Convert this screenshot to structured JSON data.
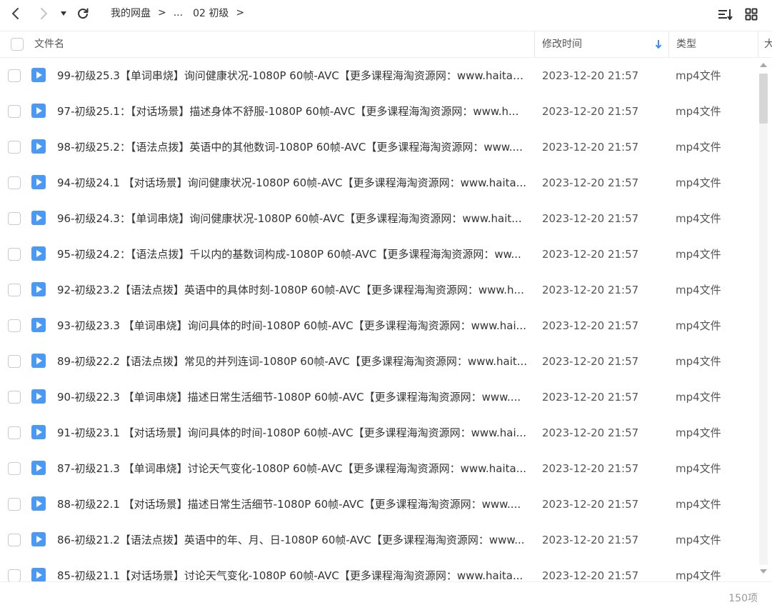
{
  "nav": {
    "back_icon": "chevron-left-icon",
    "forward_icon": "chevron-right-icon",
    "history_icon": "caret-down-icon",
    "refresh_icon": "refresh-icon"
  },
  "breadcrumb": {
    "root": "我的网盘",
    "ellipsis": "...",
    "current": "02 初级",
    "separator": ">"
  },
  "view": {
    "sort_icon": "sort-icon",
    "grid_icon": "grid-view-icon"
  },
  "columns": {
    "name": "文件名",
    "modified": "修改时间",
    "type": "类型",
    "size": "大"
  },
  "colors": {
    "accent": "#3b8ff0",
    "icon_blue": "#4a9af5"
  },
  "files": [
    {
      "name": "99-初级25.3【单词串烧】询问健康状况-1080P 60帧-AVC【更多课程海淘资源网：www.haitao...",
      "time": "2023-12-20 21:57",
      "type": "mp4文件"
    },
    {
      "name": "97-初级25.1：【对话场景】描述身体不舒服-1080P 60帧-AVC【更多课程海淘资源网：www.h...",
      "time": "2023-12-20 21:57",
      "type": "mp4文件"
    },
    {
      "name": "98-初级25.2：【语法点拨】英语中的其他数词-1080P 60帧-AVC【更多课程海淘资源网：www....",
      "time": "2023-12-20 21:57",
      "type": "mp4文件"
    },
    {
      "name": "94-初级24.1 【对话场景】询问健康状况-1080P 60帧-AVC【更多课程海淘资源网：www.haita...",
      "time": "2023-12-20 21:57",
      "type": "mp4文件"
    },
    {
      "name": "96-初级24.3：【单词串烧】询问健康状况-1080P 60帧-AVC【更多课程海淘资源网：www.hait...",
      "time": "2023-12-20 21:57",
      "type": "mp4文件"
    },
    {
      "name": "95-初级24.2：【语法点拨】千以内的基数词构成-1080P 60帧-AVC【更多课程海淘资源网：ww...",
      "time": "2023-12-20 21:57",
      "type": "mp4文件"
    },
    {
      "name": "92-初级23.2【语法点拨】英语中的具体时刻-1080P 60帧-AVC【更多课程海淘资源网：www.h...",
      "time": "2023-12-20 21:57",
      "type": "mp4文件"
    },
    {
      "name": "93-初级23.3 【单词串烧】询问具体的时间-1080P 60帧-AVC【更多课程海淘资源网：www.hai...",
      "time": "2023-12-20 21:57",
      "type": "mp4文件"
    },
    {
      "name": "89-初级22.2【语法点拨】常见的并列连词-1080P 60帧-AVC【更多课程海淘资源网：www.hait...",
      "time": "2023-12-20 21:57",
      "type": "mp4文件"
    },
    {
      "name": "90-初级22.3 【单词串烧】描述日常生活细节-1080P 60帧-AVC【更多课程海淘资源网：www....",
      "time": "2023-12-20 21:57",
      "type": "mp4文件"
    },
    {
      "name": "91-初级23.1 【对话场景】询问具体的时间-1080P 60帧-AVC【更多课程海淘资源网：www.hai...",
      "time": "2023-12-20 21:57",
      "type": "mp4文件"
    },
    {
      "name": "87-初级21.3 【单词串烧】讨论天气变化-1080P 60帧-AVC【更多课程海淘资源网：www.haita...",
      "time": "2023-12-20 21:57",
      "type": "mp4文件"
    },
    {
      "name": "88-初级22.1 【对话场景】描述日常生活细节-1080P 60帧-AVC【更多课程海淘资源网：www....",
      "time": "2023-12-20 21:57",
      "type": "mp4文件"
    },
    {
      "name": "86-初级21.2【语法点拨】英语中的年、月、日-1080P 60帧-AVC【更多课程海淘资源网：www...",
      "time": "2023-12-20 21:57",
      "type": "mp4文件"
    },
    {
      "name": "85-初级21.1【对话场景】讨论天气变化-1080P 60帧-AVC【更多课程海淘资源网：www.haita...",
      "time": "2023-12-20 21:57",
      "type": "mp4文件"
    }
  ],
  "footer": {
    "count": "150项"
  }
}
